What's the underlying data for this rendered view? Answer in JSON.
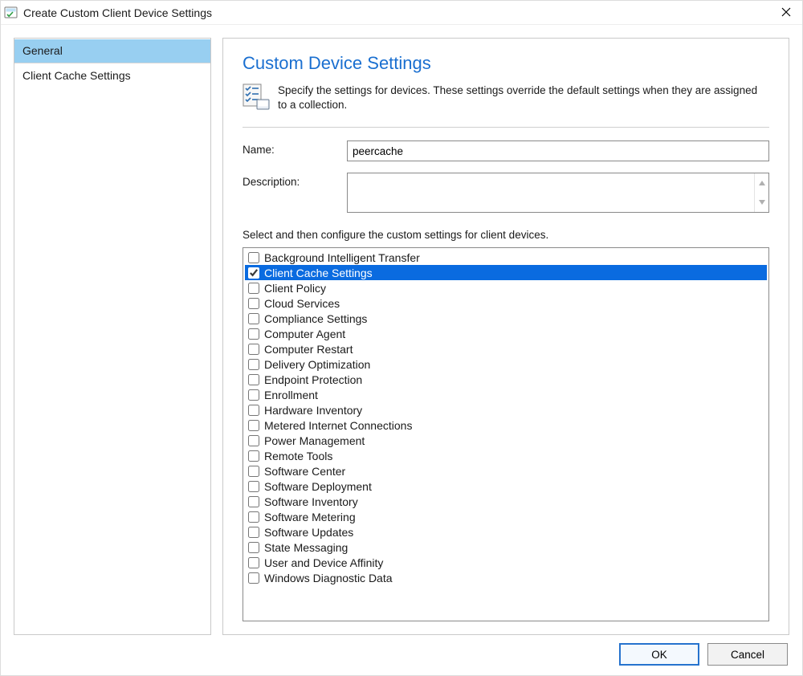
{
  "window": {
    "title": "Create Custom Client Device Settings"
  },
  "sidebar": {
    "items": [
      {
        "label": "General",
        "selected": true
      },
      {
        "label": "Client Cache Settings",
        "selected": false
      }
    ]
  },
  "main": {
    "heading": "Custom Device Settings",
    "intro": "Specify the settings for devices. These settings override the default settings when they are assigned to a collection.",
    "name_label": "Name:",
    "name_value": "peercache",
    "description_label": "Description:",
    "description_value": "",
    "instruction": "Select and then configure the custom settings for client devices.",
    "settings": [
      {
        "label": "Background Intelligent Transfer",
        "checked": false,
        "selected": false
      },
      {
        "label": "Client Cache Settings",
        "checked": true,
        "selected": true
      },
      {
        "label": "Client Policy",
        "checked": false,
        "selected": false
      },
      {
        "label": "Cloud Services",
        "checked": false,
        "selected": false
      },
      {
        "label": "Compliance Settings",
        "checked": false,
        "selected": false
      },
      {
        "label": "Computer Agent",
        "checked": false,
        "selected": false
      },
      {
        "label": "Computer Restart",
        "checked": false,
        "selected": false
      },
      {
        "label": "Delivery Optimization",
        "checked": false,
        "selected": false
      },
      {
        "label": "Endpoint Protection",
        "checked": false,
        "selected": false
      },
      {
        "label": "Enrollment",
        "checked": false,
        "selected": false
      },
      {
        "label": "Hardware Inventory",
        "checked": false,
        "selected": false
      },
      {
        "label": "Metered Internet Connections",
        "checked": false,
        "selected": false
      },
      {
        "label": "Power Management",
        "checked": false,
        "selected": false
      },
      {
        "label": "Remote Tools",
        "checked": false,
        "selected": false
      },
      {
        "label": "Software Center",
        "checked": false,
        "selected": false
      },
      {
        "label": "Software Deployment",
        "checked": false,
        "selected": false
      },
      {
        "label": "Software Inventory",
        "checked": false,
        "selected": false
      },
      {
        "label": "Software Metering",
        "checked": false,
        "selected": false
      },
      {
        "label": "Software Updates",
        "checked": false,
        "selected": false
      },
      {
        "label": "State Messaging",
        "checked": false,
        "selected": false
      },
      {
        "label": "User and Device Affinity",
        "checked": false,
        "selected": false
      },
      {
        "label": "Windows Diagnostic Data",
        "checked": false,
        "selected": false
      }
    ]
  },
  "footer": {
    "ok": "OK",
    "cancel": "Cancel"
  }
}
